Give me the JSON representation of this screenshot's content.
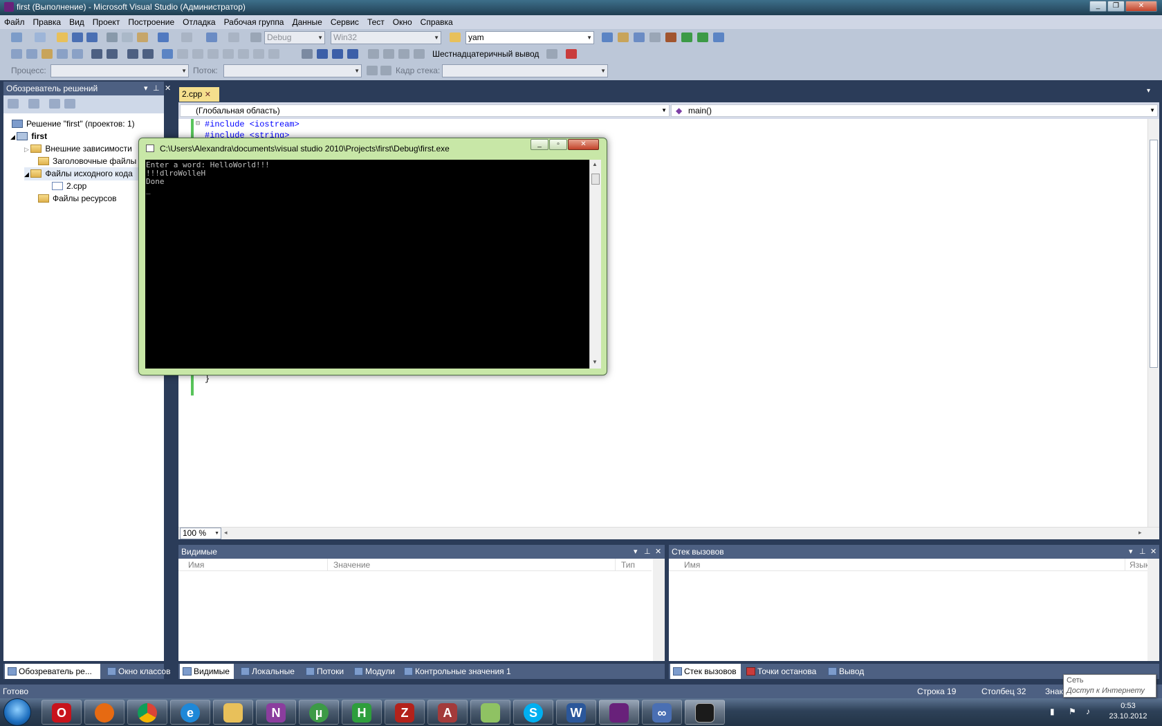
{
  "window": {
    "title": "first (Выполнение) - Microsoft Visual Studio (Администратор)"
  },
  "menu": [
    "Файл",
    "Правка",
    "Вид",
    "Проект",
    "Построение",
    "Отладка",
    "Рабочая группа",
    "Данные",
    "Сервис",
    "Тест",
    "Окно",
    "Справка"
  ],
  "toolbar1": {
    "config": "Debug",
    "platform": "Win32",
    "find": "yam"
  },
  "toolbar2": {
    "hex_label": "Шестнадцатеричный вывод"
  },
  "toolbar3": {
    "process_label": "Процесс:",
    "thread_label": "Поток:",
    "stackframe_label": "Кадр стека:"
  },
  "solution_explorer": {
    "title": "Обозреватель решений",
    "items": [
      {
        "label": "Решение \"first\"  (проектов: 1)"
      },
      {
        "label": "first"
      },
      {
        "label": "Внешние зависимости"
      },
      {
        "label": "Заголовочные файлы"
      },
      {
        "label": "Файлы исходного кода"
      },
      {
        "label": "2.cpp"
      },
      {
        "label": "Файлы ресурсов"
      }
    ],
    "tabs": [
      "Обозреватель ре...",
      "Окно классов"
    ]
  },
  "editor": {
    "tab": "2.cpp",
    "scope": "(Глобальная область)",
    "member": "main()",
    "lines": [
      "#include <iostream>",
      "#include <string>"
    ],
    "closing_brace": "}",
    "zoom": "100 %"
  },
  "console": {
    "title": "C:\\Users\\Alexandra\\documents\\visual studio 2010\\Projects\\first\\Debug\\first.exe",
    "output": "Enter a word: HelloWorld!!!\n!!!dlroWolleH\nDone\n_"
  },
  "locals_panel": {
    "title": "Видимые",
    "columns": [
      "Имя",
      "Значение",
      "Тип"
    ],
    "tabs": [
      "Видимые",
      "Локальные",
      "Потоки",
      "Модули",
      "Контрольные значения 1"
    ]
  },
  "callstack_panel": {
    "title": "Стек вызовов",
    "columns": [
      "Имя",
      "Язык"
    ],
    "tabs": [
      "Стек вызовов",
      "Точки останова",
      "Вывод"
    ]
  },
  "status": {
    "ready": "Готово",
    "line": "Строка 19",
    "column": "Столбец 32",
    "char": "Знак"
  },
  "tooltip": {
    "line1": "Сеть",
    "line2": "Доступ к Интернету"
  },
  "clock": {
    "time": "0:53",
    "date": "23.10.2012"
  },
  "taskbar_apps": [
    "Windows start",
    "Opera",
    "Firefox",
    "Chrome",
    "Internet Explorer",
    "Explorer",
    "OneNote",
    "uTorrent",
    "HTML editor",
    "FileZilla",
    "Access",
    "Notepad++",
    "Skype",
    "Word",
    "Visual Studio",
    "Infinity",
    "Console"
  ]
}
